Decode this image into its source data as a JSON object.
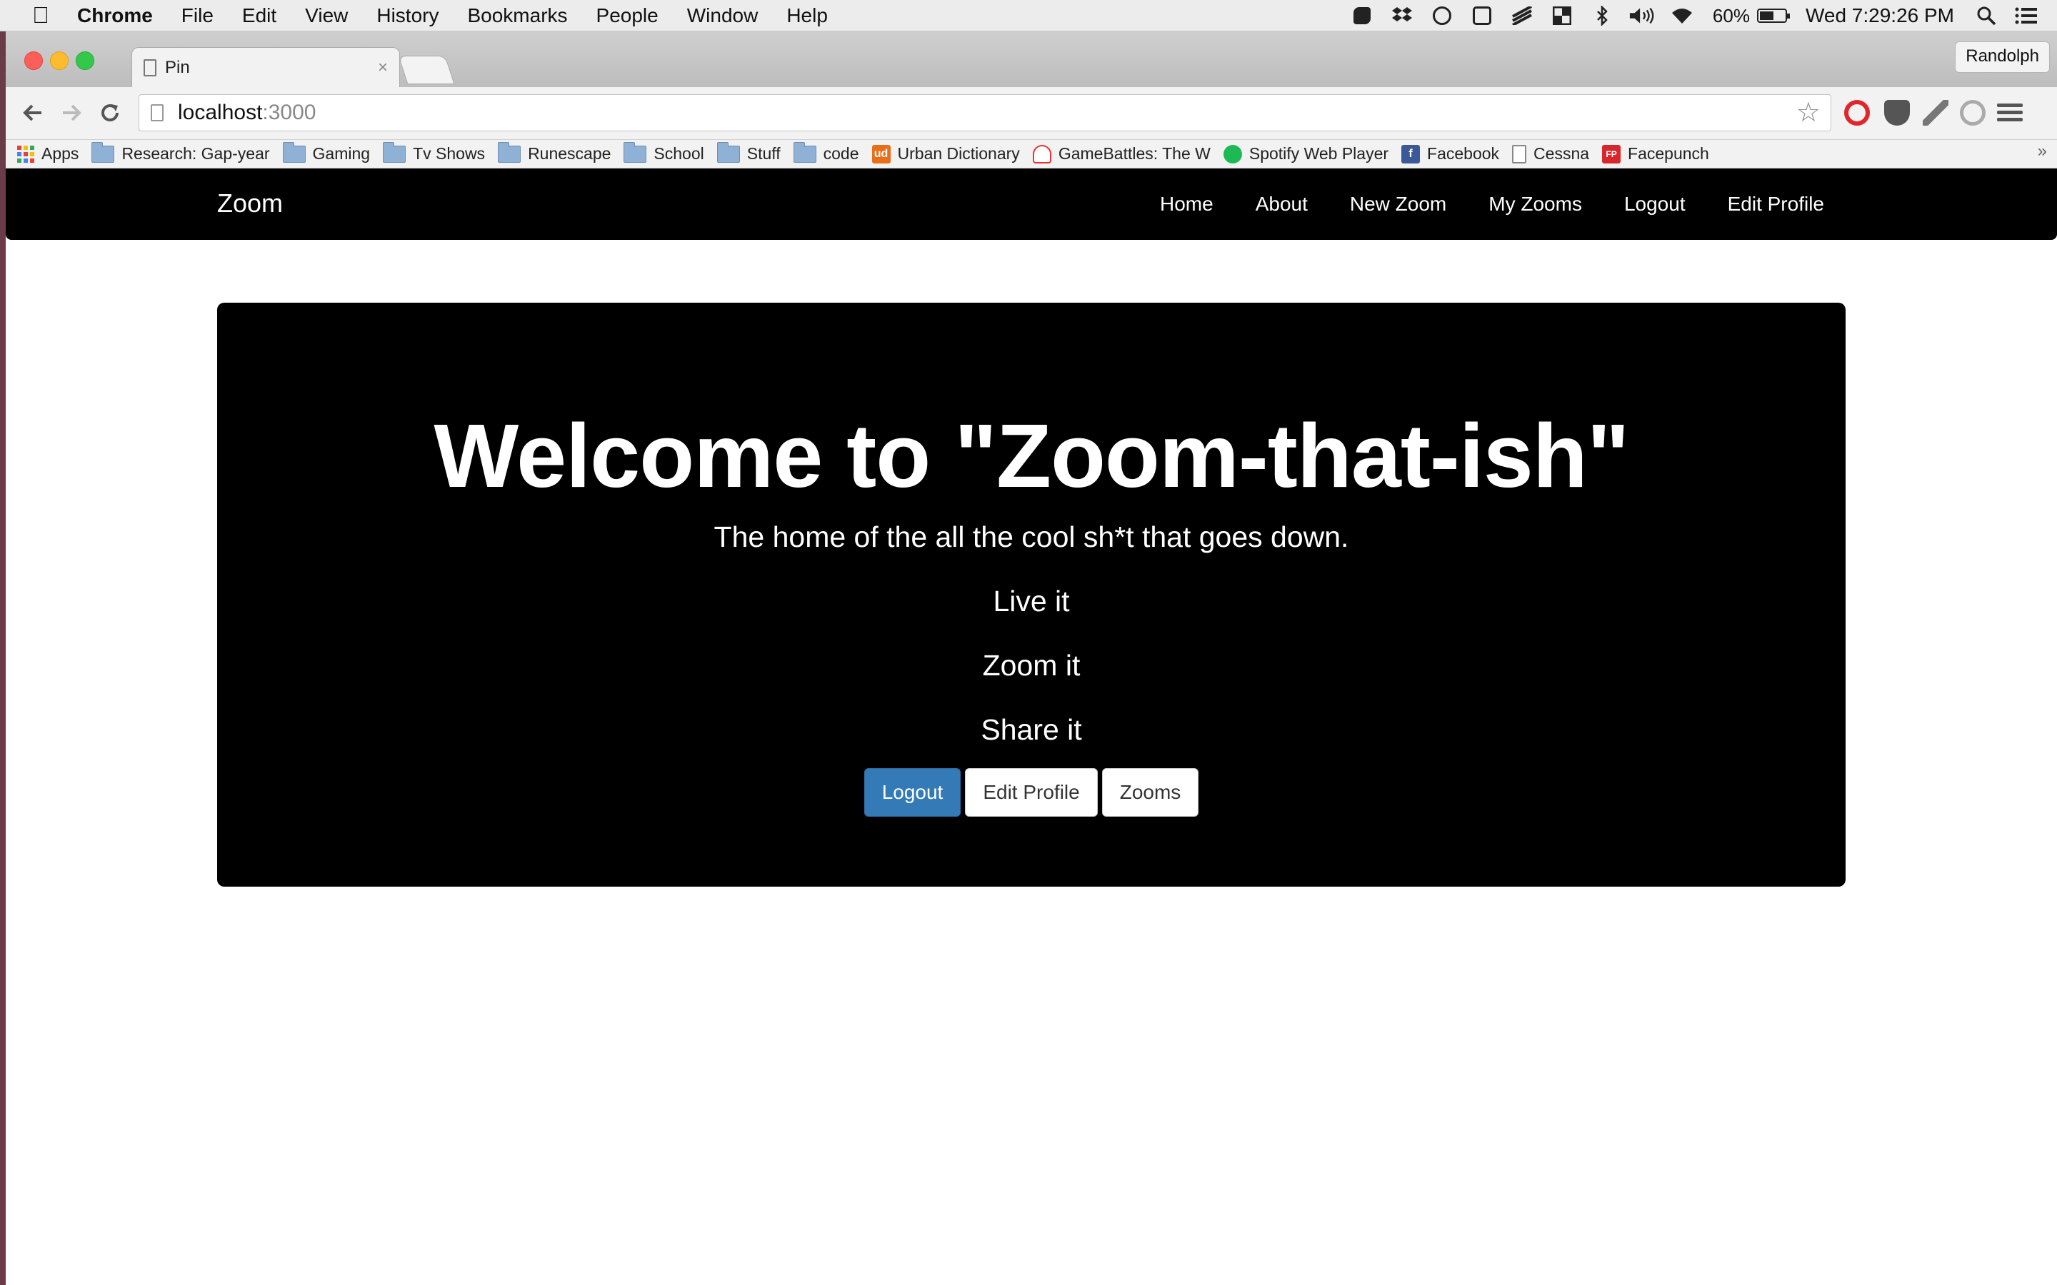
{
  "menubar": {
    "app_name": "Chrome",
    "items": [
      "File",
      "Edit",
      "View",
      "History",
      "Bookmarks",
      "People",
      "Window",
      "Help"
    ],
    "battery_percent": "60%",
    "battery_level": 0.6,
    "clock": "Wed 7:29:26 PM",
    "status_icons": [
      "evernote-icon",
      "dropbox-icon",
      "cloud-icon",
      "record-icon",
      "layers-icon",
      "grid-icon",
      "bluetooth-icon",
      "volume-icon",
      "wifi-icon",
      "battery-icon",
      "spotlight-icon",
      "notification-center-icon"
    ]
  },
  "browser": {
    "tab": {
      "title": "Pin",
      "close": "×"
    },
    "profile_name": "Randolph",
    "address": {
      "host": "localhost",
      "port": ":3000"
    },
    "bookmarks": [
      {
        "label": "Apps",
        "icon": "apps-grid-icon"
      },
      {
        "label": "Research: Gap-year",
        "icon": "folder-icon"
      },
      {
        "label": "Gaming",
        "icon": "folder-icon"
      },
      {
        "label": "Tv Shows",
        "icon": "folder-icon"
      },
      {
        "label": "Runescape",
        "icon": "folder-icon"
      },
      {
        "label": "School",
        "icon": "folder-icon"
      },
      {
        "label": "Stuff",
        "icon": "folder-icon"
      },
      {
        "label": "code",
        "icon": "folder-icon"
      },
      {
        "label": "Urban Dictionary",
        "icon": "urban-dictionary-icon",
        "badge": "ud"
      },
      {
        "label": "GameBattles: The W",
        "icon": "gamebattles-icon"
      },
      {
        "label": "Spotify Web Player",
        "icon": "spotify-icon"
      },
      {
        "label": "Facebook",
        "icon": "facebook-icon",
        "badge": "f"
      },
      {
        "label": "Cessna",
        "icon": "document-icon"
      },
      {
        "label": "Facepunch",
        "icon": "facepunch-icon",
        "badge": "FP"
      }
    ],
    "overflow": "»"
  },
  "site": {
    "brand": "Zoom",
    "nav": [
      "Home",
      "About",
      "New Zoom",
      "My Zooms",
      "Logout",
      "Edit Profile"
    ],
    "hero": {
      "title": "Welcome to \"Zoom-that-ish\"",
      "subtitle": "The home of the all the cool sh*t that goes down.",
      "lines": [
        "Live it",
        "Zoom it",
        "Share it"
      ],
      "buttons": [
        "Logout",
        "Edit Profile",
        "Zooms"
      ]
    }
  },
  "colors": {
    "navbar_bg": "#000000",
    "jumbotron_bg": "#000000",
    "primary_button": "#337ab7",
    "page_bg": "#ffffff"
  }
}
